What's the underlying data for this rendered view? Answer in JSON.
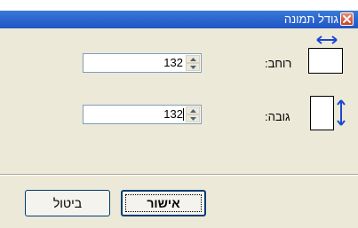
{
  "dialog": {
    "title": "גודל תמונה",
    "close_icon": "close-icon"
  },
  "width_row": {
    "label": "רוחב:",
    "value": "132",
    "icon": "width-arrow-icon"
  },
  "height_row": {
    "label": "גובה:",
    "value": "132",
    "icon": "height-arrow-icon"
  },
  "buttons": {
    "ok_label": "אישור",
    "cancel_label": "ביטול"
  },
  "colors": {
    "titlebar": "#2f6bd1",
    "window_bg": "#ece9d8",
    "arrow": "#1a47d6",
    "close": "#c9421e"
  }
}
